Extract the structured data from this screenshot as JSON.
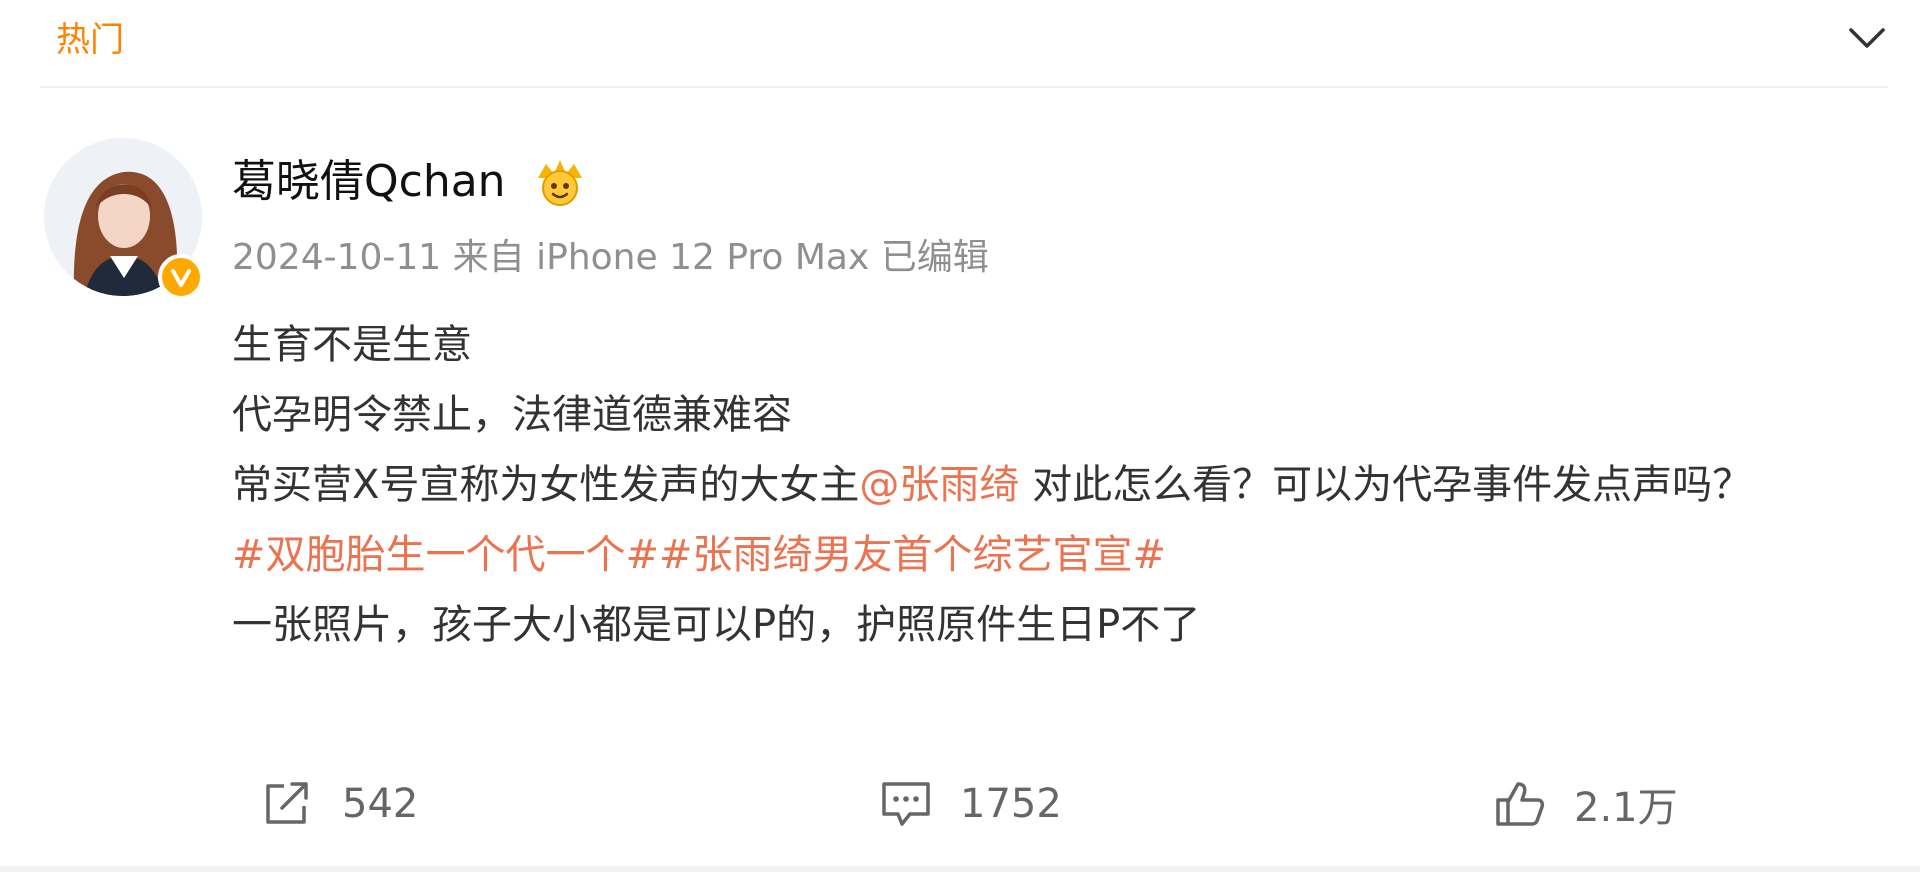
{
  "header": {
    "tab_label": "热门"
  },
  "user": {
    "name": "葛晓倩Qchan",
    "verified_color": "#ffa800",
    "badge_icon": "crown-face-icon"
  },
  "meta": {
    "text": "2024-10-11  来自 iPhone 12 Pro Max 已编辑"
  },
  "post": {
    "line1": "生育不是生意",
    "line2": "代孕明令禁止，法律道德兼难容",
    "line3_prefix": "常买营X号宣称为女性发声的大女主",
    "mention": "@张雨绮",
    "line3_suffix": " 对此怎么看？可以为代孕事件发点声吗？",
    "hashtag1": "#双胞胎生一个代一个#",
    "hashtag2": "#张雨绮男友首个综艺官宣#",
    "line5": "一张照片，孩子大小都是可以P的，护照原件生日P不了"
  },
  "actions": {
    "repost_count": "542",
    "comment_count": "1752",
    "like_count": "2.1万"
  },
  "colors": {
    "accent": "#ff8200",
    "link": "#eb7350"
  }
}
